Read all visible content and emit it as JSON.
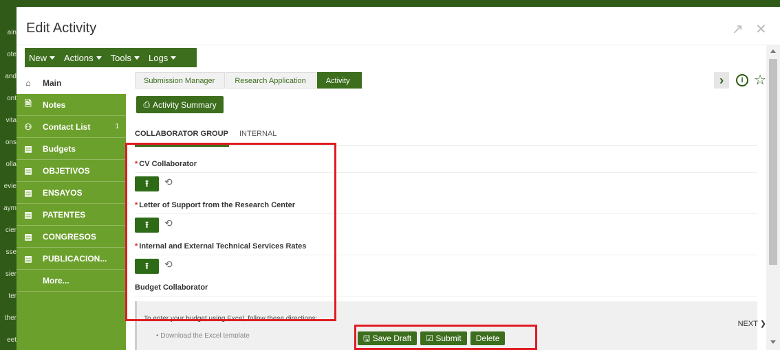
{
  "modal": {
    "title": "Edit Activity"
  },
  "menubar": {
    "items": [
      "New",
      "Actions",
      "Tools",
      "Logs"
    ]
  },
  "sidebar": {
    "items": [
      {
        "label": "Main",
        "icon": "home-icon",
        "count": ""
      },
      {
        "label": "Notes",
        "icon": "note-icon",
        "count": ""
      },
      {
        "label": "Contact List",
        "icon": "people-icon",
        "count": "1"
      },
      {
        "label": "Budgets",
        "icon": "list-icon",
        "count": ""
      },
      {
        "label": "OBJETIVOS",
        "icon": "list-icon",
        "count": ""
      },
      {
        "label": "ENSAYOS",
        "icon": "list-icon",
        "count": ""
      },
      {
        "label": "PATENTES",
        "icon": "list-icon",
        "count": ""
      },
      {
        "label": "CONGRESOS",
        "icon": "list-icon",
        "count": ""
      },
      {
        "label": "PUBLICACION...",
        "icon": "list-icon",
        "count": ""
      },
      {
        "label": "More...",
        "icon": "",
        "count": ""
      }
    ]
  },
  "breadcrumb": [
    "Submission Manager",
    "Research Application",
    "Activity"
  ],
  "summary_button": "Activity Summary",
  "tabs": [
    "COLLABORATOR GROUP",
    "INTERNAL"
  ],
  "fields": [
    {
      "label": "CV Collaborator",
      "required": "*"
    },
    {
      "label": "Letter of Support from the Research Center",
      "required": "*"
    },
    {
      "label": "Internal and External Technical Services Rates",
      "required": "*"
    }
  ],
  "budget": {
    "label": "Budget Collaborator",
    "instructions": "To enter your budget using Excel, follow these directions:",
    "bullet": "• Download the Excel template"
  },
  "next_label": "NEXT",
  "actions": {
    "save_draft": "Save Draft",
    "submit": "Submit",
    "delete": "Delete"
  },
  "colors": {
    "brand_green": "#3d6e1e",
    "sidebar_green": "#6ca02c",
    "highlight": "#e11b22"
  },
  "background": {
    "left_items": [
      "ain",
      "ote",
      "and",
      "ont",
      "vita",
      "ons",
      "olla",
      "evie",
      "aym",
      "cier",
      "sse",
      "sier",
      "ter",
      "ther",
      "eet"
    ]
  }
}
